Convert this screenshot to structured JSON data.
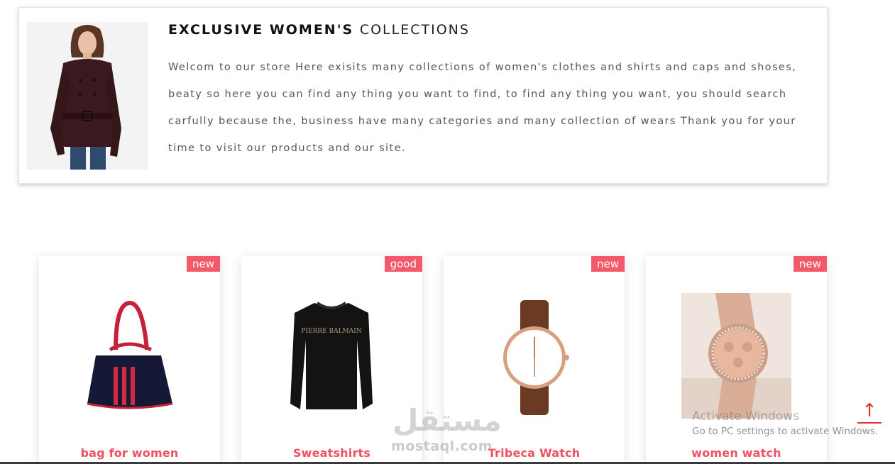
{
  "intro": {
    "title_bold": "EXCLUSIVE WOMEN'S",
    "title_light": "COLLECTIONS",
    "text": "Welcom to our store Here exisits many collections of women's clothes and shirts and caps and shoses, beaty so here you can find any thing you want to find, to find any thing you want, you should search carfully because the, business have many categories and many collection of wears Thank you for your time to visit our products and our site."
  },
  "products": [
    {
      "badge": "new",
      "name": "bag for women",
      "image": "handbag-image"
    },
    {
      "badge": "good",
      "name": "Sweatshirts",
      "image": "sweatshirt-image",
      "image_text": "PIERRE BALMAIN"
    },
    {
      "badge": "new",
      "name": "Tribeca Watch",
      "image": "watch-image"
    },
    {
      "badge": "new",
      "name": "women watch",
      "image": "women-watch-image"
    }
  ],
  "overlay": {
    "watermark_logo": "مستقل",
    "watermark_domain": "mostaql.com",
    "activation_title": "Activate Windows",
    "activation_text": "Go to PC settings to activate Windows.",
    "scroll_top_icon": "arrow-up-icon",
    "scroll_top_glyph": "↑"
  },
  "colors": {
    "accent": "#f25a6a",
    "product_name": "#f0505f"
  }
}
